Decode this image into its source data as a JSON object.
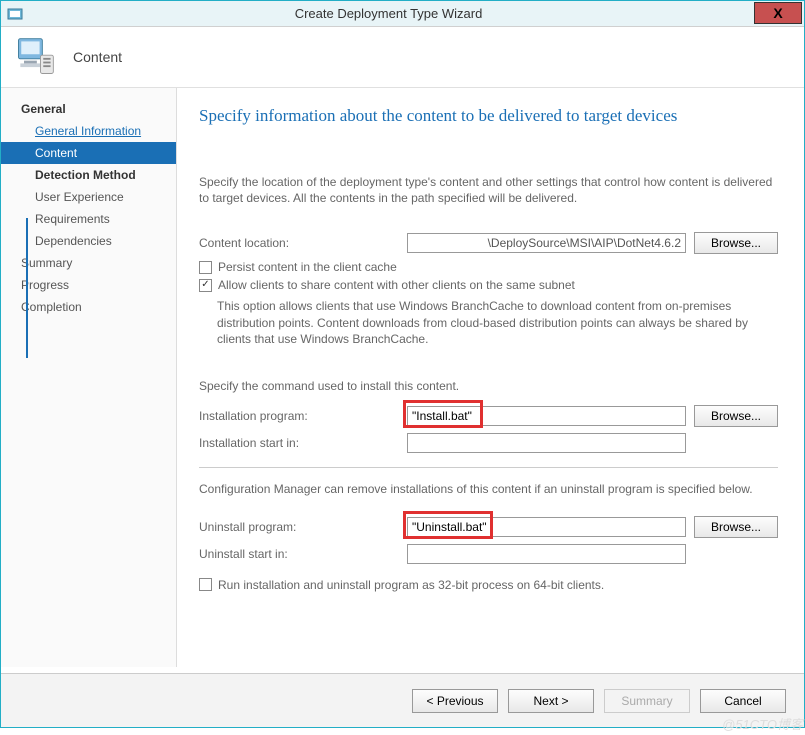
{
  "window": {
    "title": "Create Deployment Type Wizard",
    "close": "X"
  },
  "header": {
    "title": "Content"
  },
  "sidebar": {
    "items": [
      {
        "label": "General",
        "level": 1,
        "bold": true
      },
      {
        "label": "General Information",
        "level": 2,
        "link": true
      },
      {
        "label": "Content",
        "level": 2,
        "selected": true
      },
      {
        "label": "Detection Method",
        "level": 2,
        "bold": true
      },
      {
        "label": "User Experience",
        "level": 2
      },
      {
        "label": "Requirements",
        "level": 2
      },
      {
        "label": "Dependencies",
        "level": 2
      },
      {
        "label": "Summary",
        "level": 1
      },
      {
        "label": "Progress",
        "level": 1
      },
      {
        "label": "Completion",
        "level": 1
      }
    ]
  },
  "content": {
    "pageTitle": "Specify information about the content to be delivered to target devices",
    "description": "Specify the location of the deployment type's content and other settings that control how content is delivered to target devices. All the contents in the path specified will be delivered.",
    "contentLocationLabel": "Content location:",
    "contentLocationValue": "\\DeploySource\\MSI\\AIP\\DotNet4.6.2",
    "browse": "Browse...",
    "persistLabel": "Persist content in the client cache",
    "allowShareLabel": "Allow clients to share content with other clients on the same subnet",
    "branchCacheNote": "This option allows clients that use Windows BranchCache to download content from on-premises distribution points. Content downloads from cloud-based distribution points can always be shared by clients that use Windows BranchCache.",
    "installCmdSection": "Specify the command used to install this content.",
    "installProgramLabel": "Installation program:",
    "installProgramValue": "\"Install.bat\"",
    "installStartInLabel": "Installation start in:",
    "installStartInValue": "",
    "configMgrNote": "Configuration Manager can remove installations of this content if an uninstall program is specified below.",
    "uninstallProgramLabel": "Uninstall program:",
    "uninstallProgramValue": "\"Uninstall.bat\"",
    "uninstallStartInLabel": "Uninstall start in:",
    "uninstallStartInValue": "",
    "run32bitLabel": "Run installation and uninstall program as 32-bit process on 64-bit clients."
  },
  "footer": {
    "previous": "< Previous",
    "next": "Next >",
    "summary": "Summary",
    "cancel": "Cancel"
  },
  "watermark": "@51CTO博客"
}
